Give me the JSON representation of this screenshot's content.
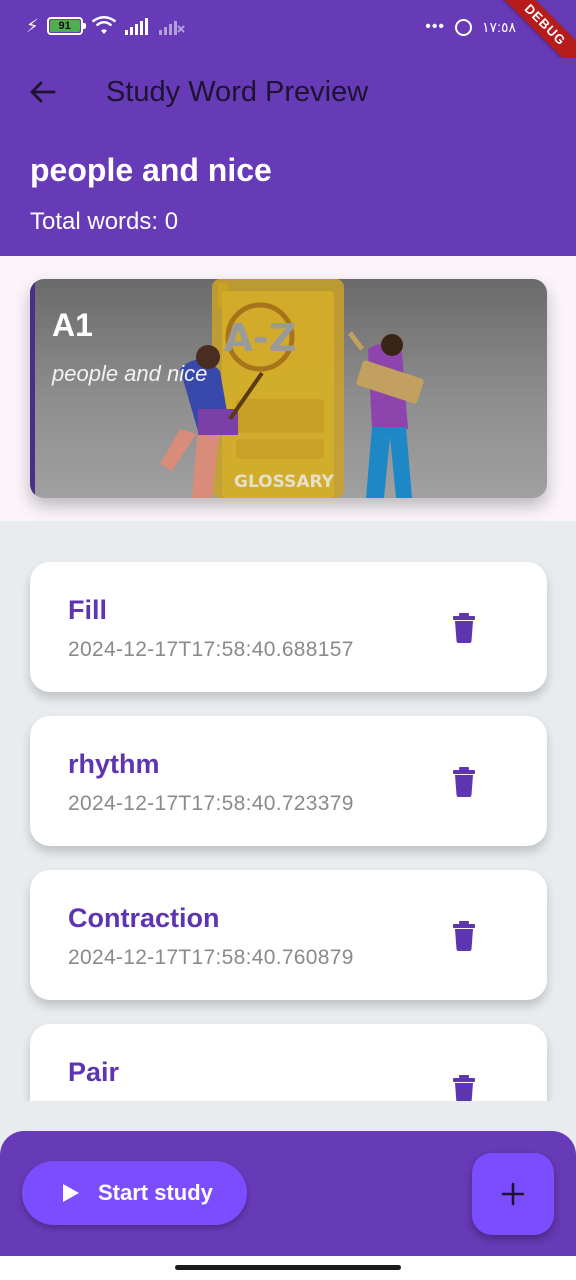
{
  "status_bar": {
    "battery_level": "91",
    "time": "١٧:٥٨",
    "debug_banner": "DEBUG"
  },
  "app_bar": {
    "title": "Study Word Preview",
    "deck_name": "people and nice",
    "total_words_label": "Total words: 0"
  },
  "hero_card": {
    "level": "A1",
    "subtitle": "people and nice",
    "illustration": {
      "book_letters": "A-Z",
      "book_label": "GLOSSARY"
    }
  },
  "words": [
    {
      "term": "Fill",
      "created_at": "2024-12-17T17:58:40.688157"
    },
    {
      "term": "rhythm",
      "created_at": "2024-12-17T17:58:40.723379"
    },
    {
      "term": "Contraction",
      "created_at": "2024-12-17T17:58:40.760879"
    },
    {
      "term": "Pair",
      "created_at": ""
    }
  ],
  "bottom_bar": {
    "start_study_label": "Start study"
  },
  "colors": {
    "primary": "#673ab7",
    "accent": "#7c4dff",
    "word_term": "#5e35b1",
    "delete_icon": "#5e35b1"
  },
  "icons": {
    "back": "arrow-left-icon",
    "delete": "trash-icon",
    "play": "play-icon",
    "add": "plus-icon"
  }
}
